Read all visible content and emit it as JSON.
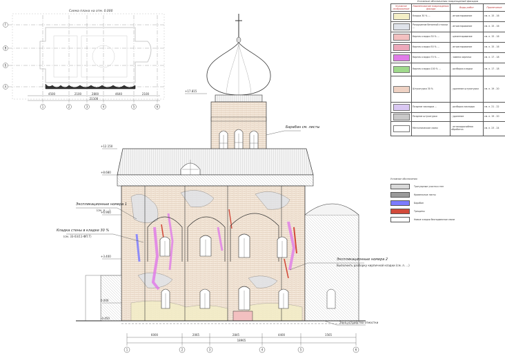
{
  "plan": {
    "title": "Схема плана на отм. 0.000",
    "row_axes": [
      "Г",
      "В",
      "Б",
      "А"
    ],
    "col_axes": [
      "1",
      "2",
      "3",
      "4",
      "5",
      "6"
    ],
    "overall_dim": "21100",
    "dims": [
      "4500",
      "2100",
      "2800",
      "4640",
      "2100"
    ]
  },
  "elevation": {
    "col_axes": [
      "1",
      "2",
      "3",
      "4",
      "5",
      "6"
    ],
    "overall_dim": "18965",
    "dims": [
      "6000",
      "2065",
      "2845",
      "4400",
      "1565"
    ],
    "callouts": [
      {
        "label": "Барабан см. листы"
      },
      {
        "label": "Экспликационные номера 1",
        "sub": "(см. л. ...)"
      },
      {
        "label": "Кладка стены в кладке 30 %",
        "sub": "(см. 33-03/11-ФП.Т)"
      },
      {
        "label": "Экспликационные номера 2",
        "sub": "Выполнить разборку кирпичной кладки (см. л. ...)"
      },
      {
        "label": "Зона устройства отмостки"
      }
    ],
    "levels": [
      "+17.815",
      "+12.150",
      "+8.680",
      "+6.960",
      "+3.400",
      "0.000",
      "-0.450"
    ]
  },
  "legend": {
    "title": "Условные обозначения повреждений фасадов",
    "headers": [
      "Условное изображение",
      "Наименование повреждения фасада",
      "Виды работ",
      "Примечание"
    ],
    "rows": [
      {
        "color": "#f4efc6",
        "name": "Кладка 30 % ...",
        "work": "- инъектирование",
        "note": "см. л. 15 - 16"
      },
      {
        "color": "#dfe3ea",
        "name": "Разрушение бетонной стяжки ...",
        "work": "- инъектирование",
        "note": "см. л. 15 - 16"
      },
      {
        "color": "#f3c0c0",
        "name": "Кирпич кладки 30 % ...",
        "work": "- цементирование",
        "note": "см. л. 15 - 16"
      },
      {
        "color": "#eda9bb",
        "name": "Кирпич кладки 50 % ...",
        "work": "- инъектирование",
        "note": "см. л. 15 - 16"
      },
      {
        "color": "#e07ce8",
        "name": "Кирпич кладки 70 % ...",
        "work": "- замена кирпича",
        "note": "см. л. 17 - 18"
      },
      {
        "color": "#9fd98b",
        "name": "Кирпич кладки 100 % ...",
        "work": "- разборка кладки",
        "note": "см. л. 17 - 18"
      },
      {
        "color": "#efd2c4",
        "name": "Штукатурка 30 %",
        "work": "- удаление штукатурки",
        "note": "см. л. 19 - 20"
      },
      {
        "color": "#d9c7f2",
        "name": "Поздние закладки ...",
        "work": "- разборка закладок",
        "note": "см. л. 21 - 22"
      },
      {
        "color": "#c9c9c9",
        "name": "Поздние штукатурки",
        "work": "- удаление",
        "note": "см. л. 19 - 20"
      },
      {
        "color": "#ffffff",
        "name": "Металлические связи",
        "work": "- антикоррозийная обработка",
        "note": "см. л. 23 - 24"
      }
    ]
  },
  "small_legend": {
    "title": "Условные обозначения",
    "items": [
      {
        "color": "#d8d8d8",
        "label": "Тротуарные участки стен"
      },
      {
        "color": "#9b9b9b",
        "label": "Кровельные листы"
      },
      {
        "color": "#7c7cff",
        "label": "Барабан"
      },
      {
        "color": "#d24a3a",
        "label": "Трещины"
      },
      {
        "color": "#ffffff",
        "label": "Новые кладки бесподвесные связи"
      }
    ]
  }
}
